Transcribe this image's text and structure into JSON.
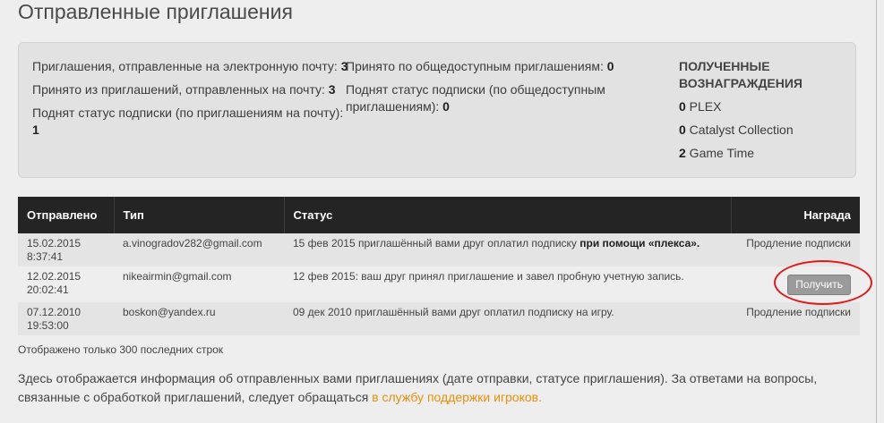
{
  "title": "Отправленные приглашения",
  "summary": {
    "col1": [
      {
        "label": "Приглашения, отправленные на электронную почту: ",
        "value": "3"
      },
      {
        "label": "Принято из приглашений, отправленных на почту: ",
        "value": "3"
      },
      {
        "label": "Поднят статус подписки (по приглашениям на почту): ",
        "value": "1"
      }
    ],
    "col2": [
      {
        "label": "Принято по общедоступным приглашениям: ",
        "value": "0"
      },
      {
        "label": "Поднят статус подписки (по общедоступным приглашениям): ",
        "value": "0"
      }
    ],
    "rewards": {
      "title": "ПОЛУЧЕННЫЕ ВОЗНАГРАЖДЕНИЯ",
      "items": [
        {
          "count": "0",
          "name": " PLEX"
        },
        {
          "count": "0",
          "name": " Catalyst Collection"
        },
        {
          "count": "2",
          "name": " Game Time"
        }
      ]
    }
  },
  "table": {
    "headers": [
      "Отправлено",
      "Тип",
      "Статус",
      "Награда"
    ],
    "rows": [
      {
        "date": "15.02.2015",
        "time": "8:37:41",
        "type": "a.vinogradov282@gmail.com",
        "status": "15 фев 2015 приглашённый вами друг оплатил подписку ",
        "status_strong": "при помощи «плекса».",
        "reward": "Продление подписки"
      },
      {
        "date": "12.02.2015",
        "time": "20:02:41",
        "type": "nikeairmin@gmail.com",
        "status": "12 фев 2015: ваш друг принял приглашение и завел пробную учетную запись.",
        "status_strong": "",
        "reward_button": "Получить"
      },
      {
        "date": "07.12.2010",
        "time": "19:53:00",
        "type": "boskon@yandex.ru",
        "status": "09 дек 2010 приглашённый вами друг оплатил подписку на игру.",
        "status_strong": "",
        "reward": "Продление подписки"
      }
    ]
  },
  "note": "Отображено только 300 последних строк",
  "footer": {
    "text": "Здесь отображается информация об отправленных вами приглашениях (дате отправки, статусе приглашения). За ответами на вопросы, связанные с обработкой приглашений, следует обращаться ",
    "link": "в службу поддержки игроков."
  },
  "colors": {
    "header_bg": "#242424",
    "link": "#e8900a",
    "highlight": "#e21a1a"
  }
}
